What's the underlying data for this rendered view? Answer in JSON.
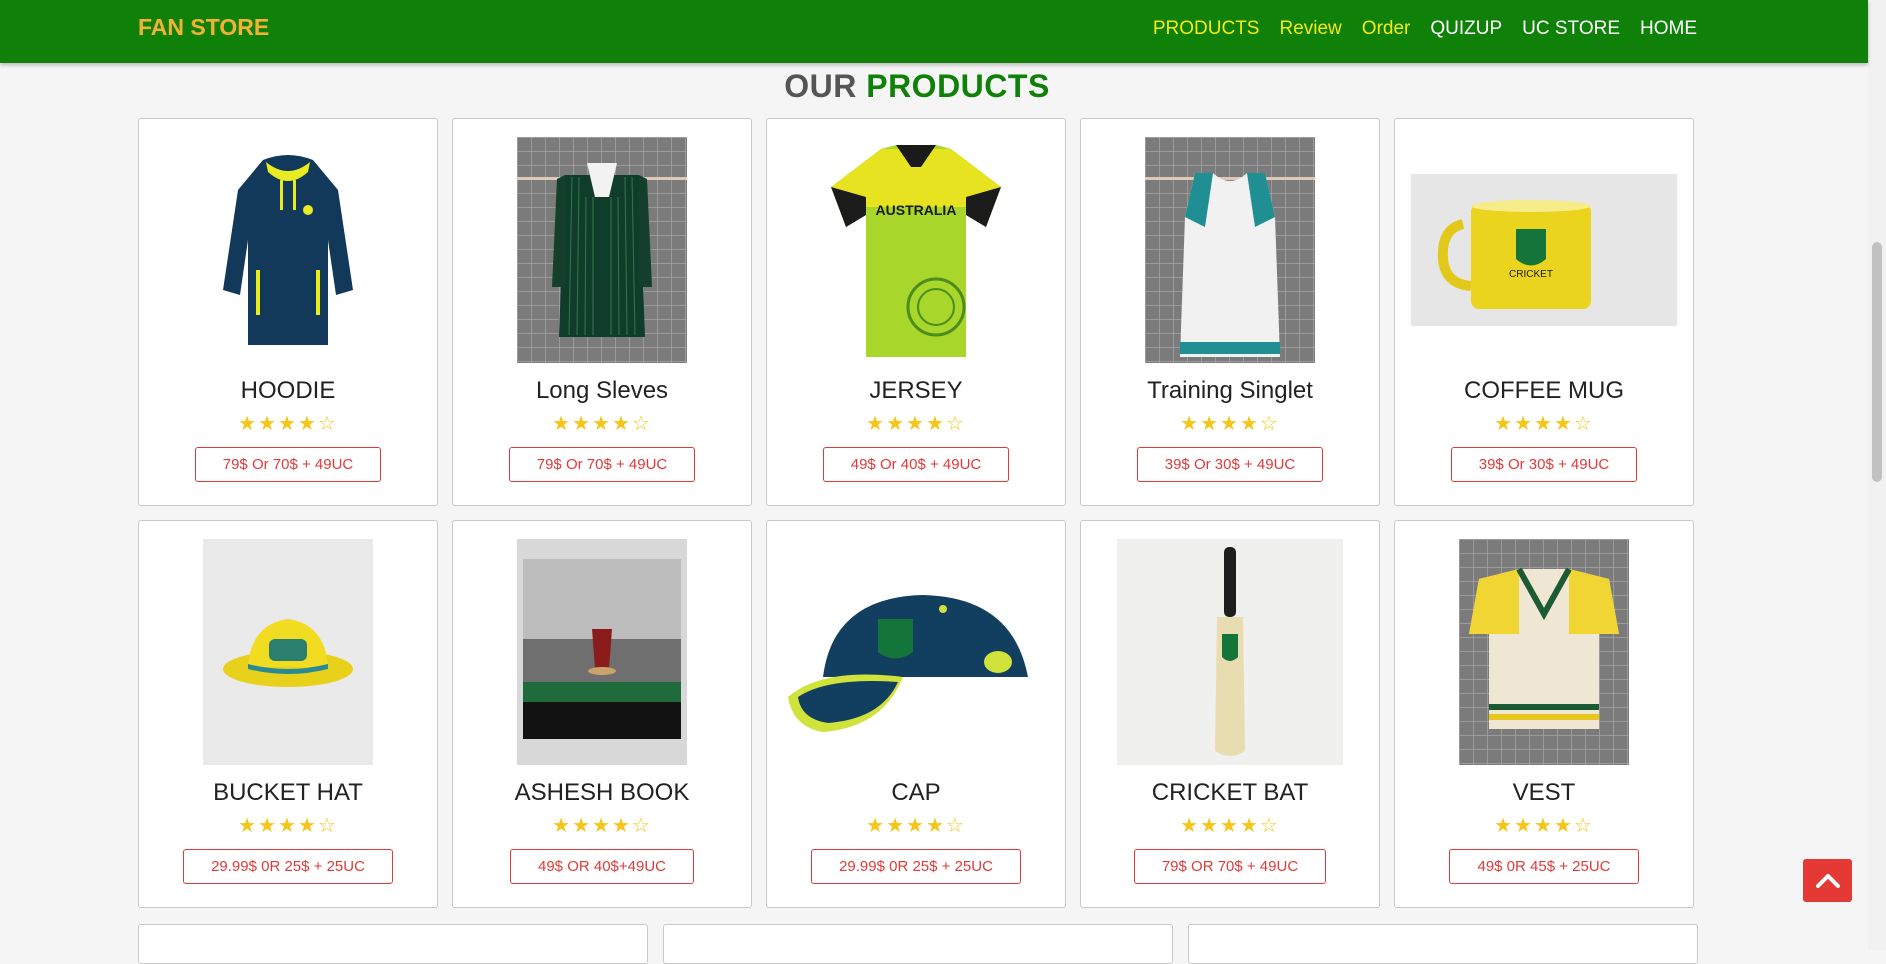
{
  "navbar": {
    "brand": "FAN STORE",
    "links": [
      {
        "label": "PRODUCTS"
      },
      {
        "label": "Review"
      },
      {
        "label": "Order"
      },
      {
        "label": "QUIZUP"
      },
      {
        "label": "UC STORE"
      },
      {
        "label": "HOME"
      }
    ]
  },
  "section": {
    "title_part1": "OUR",
    "title_part2": "PRODUCTS"
  },
  "rating": {
    "filled": 4,
    "total": 5,
    "stars_text": "★★★★☆"
  },
  "products": [
    {
      "name": "HOODIE",
      "price": "79$ Or 70$ + 49UC",
      "image": "hoodie-image"
    },
    {
      "name": "Long Sleves",
      "price": "79$ Or 70$ + 49UC",
      "image": "blazer-image"
    },
    {
      "name": "JERSEY",
      "price": "49$ Or 40$ + 49UC",
      "image": "jersey-image"
    },
    {
      "name": "Training Singlet",
      "price": "39$ Or 30$ + 49UC",
      "image": "singlet-image"
    },
    {
      "name": "COFFEE MUG",
      "price": "39$ Or 30$ + 49UC",
      "image": "mug-image"
    },
    {
      "name": "BUCKET HAT",
      "price": "29.99$ 0R 25$ + 25UC",
      "image": "bucket-hat-image"
    },
    {
      "name": "ASHESH BOOK",
      "price": "49$ OR 40$+49UC",
      "image": "book-image"
    },
    {
      "name": "CAP",
      "price": "29.99$ 0R 25$ + 25UC",
      "image": "cap-image"
    },
    {
      "name": "CRICKET BAT",
      "price": "79$ OR 70$ + 49UC",
      "image": "bat-image"
    },
    {
      "name": "VEST",
      "price": "49$ 0R 45$ + 25UC",
      "image": "vest-image"
    }
  ],
  "colors": {
    "nav_bg": "#0f8008",
    "brand": "#f2b233",
    "nav_active": "#f5ea16",
    "accent_red": "#e03a3a",
    "star": "#f5c518"
  },
  "icons": {
    "back_to_top": "chevron-up-icon",
    "rating": "star-icon"
  }
}
